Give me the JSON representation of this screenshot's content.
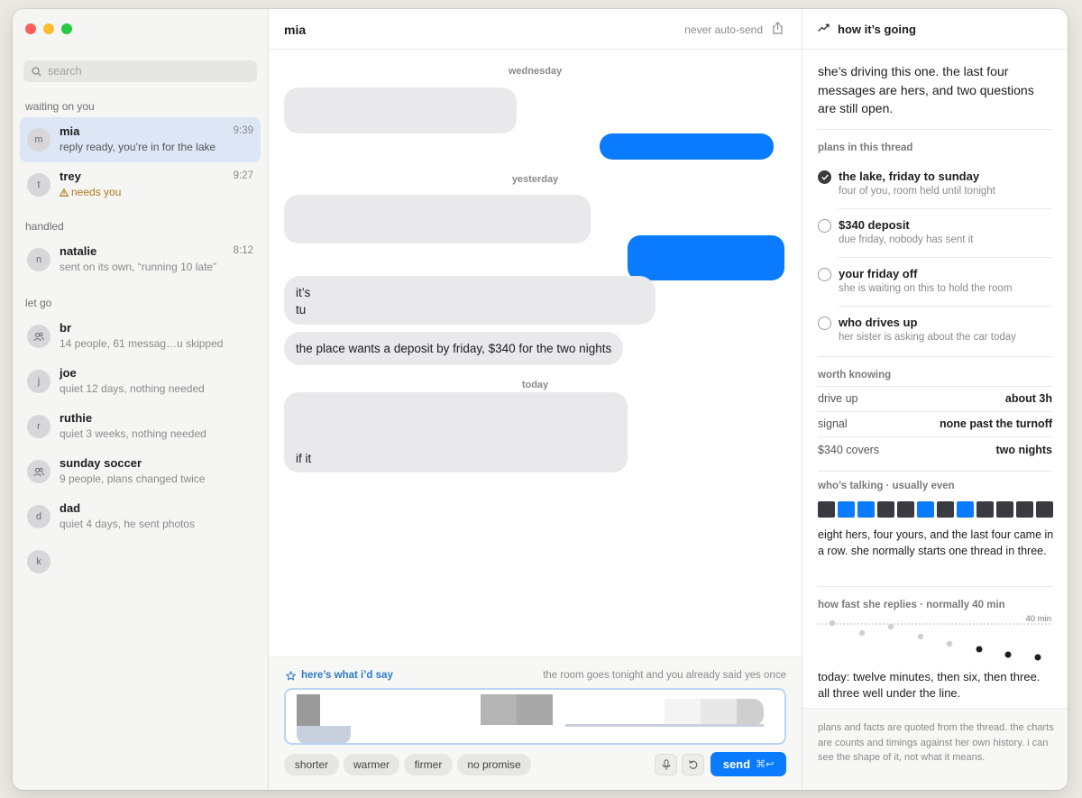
{
  "sidebar": {
    "search_placeholder": "search",
    "sections": [
      "waiting on you",
      "handled",
      "let go"
    ],
    "conversations": [
      {
        "initial": "m",
        "name": "mia",
        "time": "9:39",
        "preview": "reply ready, you’re in for the lake"
      },
      {
        "initial": "t",
        "name": "trey",
        "time": "9:27",
        "preview": "needs you"
      },
      {
        "initial": "n",
        "name": "natalie",
        "time": "8:12",
        "preview": "sent on its own, “running 10 late”"
      },
      {
        "initial": "",
        "name": "br",
        "time": "",
        "preview": "14 people, 61 messag…u skipped"
      },
      {
        "initial": "j",
        "name": "joe",
        "time": "",
        "preview": "quiet 12 days, nothing needed"
      },
      {
        "initial": "r",
        "name": "ruthie",
        "time": "",
        "preview": "quiet 3 weeks, nothing needed"
      },
      {
        "initial": "",
        "name": "sunday soccer",
        "time": "",
        "preview": "9 people, plans changed twice"
      },
      {
        "initial": "d",
        "name": "dad",
        "time": "",
        "preview": "quiet 4 days, he sent photos"
      },
      {
        "initial": "k",
        "name": "",
        "time": "",
        "preview": ""
      }
    ]
  },
  "thread": {
    "contact": "mia",
    "auto_send": "never auto-send",
    "days": [
      "wednesday",
      "yesterday",
      "today"
    ],
    "partial_1": "it’s",
    "partial_2": "tu",
    "deposit_message": "the place wants a deposit by friday, $340 for the two nights",
    "partial_3": "if it"
  },
  "composer": {
    "label": "here’s what i’d say",
    "note": "the room goes tonight and you already said yes once",
    "chips": [
      "shorter",
      "warmer",
      "firmer",
      "no promise"
    ],
    "send_label": "send",
    "send_shortcut": "⌘↩"
  },
  "panel": {
    "title": "how it’s going",
    "summary": "she’s driving this one. the last four messages are hers, and two questions are still open.",
    "plans_label": "plans in this thread",
    "plans": [
      {
        "title": "the lake, friday to sunday",
        "sub": "four of you, room held until tonight",
        "done": true
      },
      {
        "title": "$340 deposit",
        "sub": "due friday, nobody has sent it",
        "done": false
      },
      {
        "title": "your friday off",
        "sub": "she is waiting on this to hold the room",
        "done": false
      },
      {
        "title": "who drives up",
        "sub": "her sister is asking about the car today",
        "done": false
      }
    ],
    "facts_label": "worth knowing",
    "facts": [
      {
        "k": "drive up",
        "v": "about 3h"
      },
      {
        "k": "signal",
        "v": "none past the turnoff"
      },
      {
        "k": "$340 covers",
        "v": "two nights"
      }
    ],
    "talking_label": "who’s talking · usually even",
    "talking_sequence": [
      "her",
      "you",
      "you",
      "her",
      "her",
      "you",
      "her",
      "you",
      "her",
      "her",
      "her",
      "her"
    ],
    "talking_text": "eight hers, four yours, and the last four came in a row. she normally starts one thread in three.",
    "reply_label": "how fast she replies · normally 40 min",
    "reply_line_label": "40 min",
    "reply_text": "today: twelve minutes, then six, then three. all three well under the line.",
    "footnote": "plans and facts are quoted from the thread. the charts are counts and timings against her own history. i can see the shape of it, not what it means."
  },
  "colors": {
    "accent": "#0a7aff",
    "her": "#3a3a40",
    "you": "#0a7aff",
    "warn": "#b07b18"
  }
}
